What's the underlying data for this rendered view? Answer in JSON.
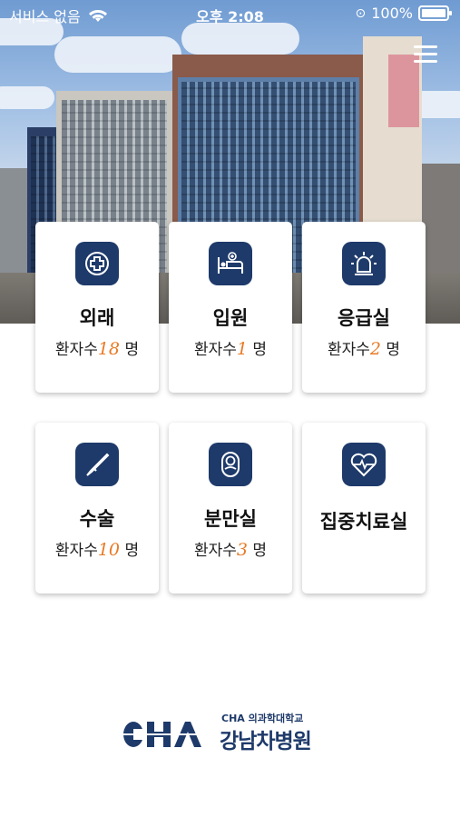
{
  "status_bar": {
    "carrier": "서비스 없음",
    "time": "오후 2:08",
    "battery": "100%"
  },
  "menu": {
    "icon": "hamburger-menu-icon"
  },
  "departments": [
    {
      "title": "외래",
      "prefix": "환자수",
      "count": "18",
      "unit": "명",
      "icon": "medical-cross-icon"
    },
    {
      "title": "입원",
      "prefix": "환자수",
      "count": "1",
      "unit": "명",
      "icon": "hospital-bed-icon"
    },
    {
      "title": "응급실",
      "prefix": "환자수",
      "count": "2",
      "unit": "명",
      "icon": "emergency-siren-icon"
    },
    {
      "title": "수술",
      "prefix": "환자수",
      "count": "10",
      "unit": "명",
      "icon": "scalpel-icon"
    },
    {
      "title": "분만실",
      "prefix": "환자수",
      "count": "3",
      "unit": "명",
      "icon": "newborn-icon"
    },
    {
      "title": "집중치료실",
      "prefix": "",
      "count": "",
      "unit": "",
      "icon": "heart-pulse-icon"
    }
  ],
  "footer": {
    "logo_mark": "CHA",
    "school": "CHA 의과학대학교",
    "hospital": "강남차병원"
  },
  "colors": {
    "accent": "#1e3a6a",
    "count": "#e87a25"
  }
}
